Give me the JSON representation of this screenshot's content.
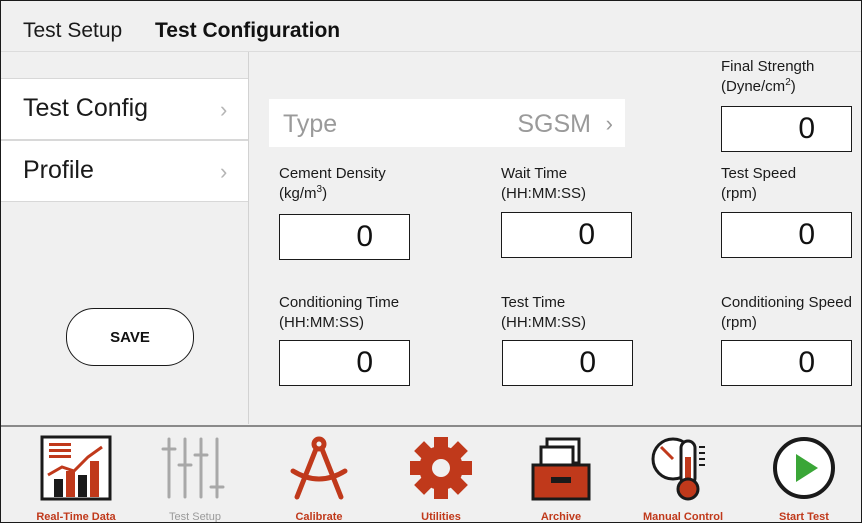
{
  "header": {
    "breadcrumb": "Test Setup",
    "title": "Test Configuration"
  },
  "sidebar": {
    "items": [
      {
        "label": "Test Config",
        "chevron": "›"
      },
      {
        "label": "Profile",
        "chevron": "›"
      }
    ],
    "save_label": "SAVE"
  },
  "type_selector": {
    "label": "Type",
    "value": "SGSM",
    "chevron": "›"
  },
  "fields": {
    "final_strength": {
      "label": "Final Strength",
      "unit_pre": "(Dyne/cm",
      "unit_sup": "2",
      "unit_post": ")",
      "value": "0"
    },
    "cement_density": {
      "label": "Cement Density",
      "unit_pre": "(kg/m",
      "unit_sup": "3",
      "unit_post": ")",
      "value": "0"
    },
    "wait_time": {
      "label": "Wait Time",
      "unit": "(HH:MM:SS)",
      "value": "0"
    },
    "test_speed": {
      "label": "Test Speed",
      "unit": "(rpm)",
      "value": "0"
    },
    "conditioning_time": {
      "label": "Conditioning Time",
      "unit": "(HH:MM:SS)",
      "value": "0"
    },
    "test_time": {
      "label": "Test Time",
      "unit": "(HH:MM:SS)",
      "value": "0"
    },
    "conditioning_speed": {
      "label": "Conditioning Speed",
      "unit": "(rpm)",
      "value": "0"
    }
  },
  "bottom_nav": [
    {
      "label": "Real-Time Data",
      "icon": "chart-icon",
      "active": true
    },
    {
      "label": "Test Setup",
      "icon": "sliders-icon",
      "active": false
    },
    {
      "label": "Calibrate",
      "icon": "compass-icon",
      "active": true
    },
    {
      "label": "Utilities",
      "icon": "gear-icon",
      "active": true
    },
    {
      "label": "Archive",
      "icon": "archive-icon",
      "active": true
    },
    {
      "label": "Manual Control",
      "icon": "thermometer-gauge-icon",
      "active": true
    },
    {
      "label": "Start Test",
      "icon": "play-icon",
      "active": true
    }
  ],
  "colors": {
    "accent": "#c0391b",
    "play_green": "#3aa637",
    "dim": "#9a9a9a",
    "background": "#f0f0f0"
  }
}
